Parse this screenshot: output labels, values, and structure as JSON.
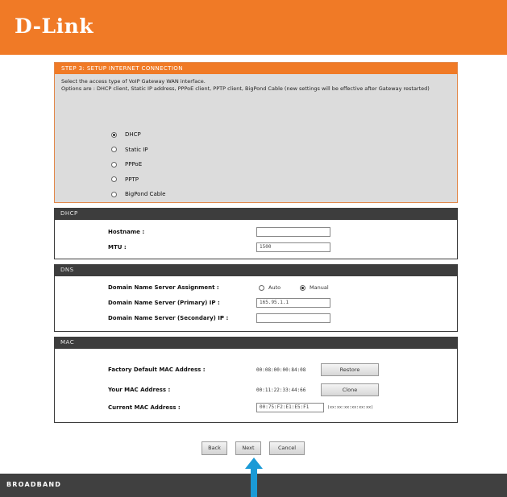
{
  "brand": {
    "logo": "D-Link",
    "footer": "BROADBAND"
  },
  "step": {
    "title": "STEP 3: SETUP INTERNET CONNECTION",
    "desc_1": "Select the access type of VoIP Gateway WAN interface.",
    "desc_2": "Options are : DHCP client, Static IP address, PPPoE client, PPTP client, BigPond Cable (new settings will be effective after Gateway restarted)",
    "options": [
      {
        "label": "DHCP",
        "selected": true
      },
      {
        "label": "Static IP",
        "selected": false
      },
      {
        "label": "PPPoE",
        "selected": false
      },
      {
        "label": "PPTP",
        "selected": false
      },
      {
        "label": "BigPond Cable",
        "selected": false
      }
    ]
  },
  "dhcp": {
    "title": "DHCP",
    "hostname_label": "Hostname :",
    "hostname_value": "",
    "mtu_label": "MTU :",
    "mtu_value": "1500"
  },
  "dns": {
    "title": "DNS",
    "assignment_label": "Domain Name Server Assignment :",
    "auto_label": "Auto",
    "manual_label": "Manual",
    "auto_selected": false,
    "manual_selected": true,
    "primary_label": "Domain Name Server (Primary) IP :",
    "primary_value": "165.95.1.1",
    "secondary_label": "Domain Name Server (Secondary) IP :",
    "secondary_value": ""
  },
  "mac": {
    "title": "MAC",
    "factory_label": "Factory Default MAC Address :",
    "factory_value": "00:08:00:00:84:08",
    "restore_label": "Restore",
    "your_label": "Your MAC Address :",
    "your_value": "00:11:22:33:44:66",
    "clone_label": "Clone",
    "current_label": "Current MAC Address :",
    "current_value": "00:75:F2:E1:E5:F1",
    "current_format": "(xx:xx:xx:xx:xx:xx)"
  },
  "nav": {
    "back": "Back",
    "next": "Next",
    "cancel": "Cancel"
  },
  "colors": {
    "brand_orange": "#f07a26",
    "section_dark": "#3d3d3d",
    "arrow_blue": "#1a9ad6"
  }
}
